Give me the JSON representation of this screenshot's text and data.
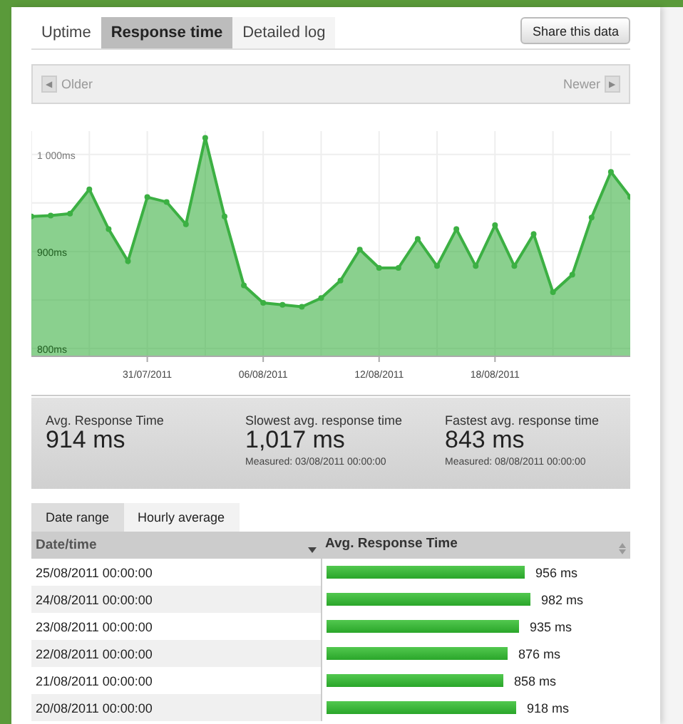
{
  "tabs": [
    {
      "label": "Uptime",
      "selected": false
    },
    {
      "label": "Response time",
      "selected": true
    },
    {
      "label": "Detailed log",
      "selected": false
    }
  ],
  "share_button": "Share this data",
  "navigation": {
    "older": "Older",
    "newer": "Newer",
    "older_icon": "◀",
    "newer_icon": "▶"
  },
  "chart_data": {
    "type": "area",
    "categories": [
      null,
      null,
      null,
      null,
      null,
      null,
      "31/07/2011",
      null,
      null,
      null,
      null,
      null,
      "06/08/2011",
      null,
      null,
      null,
      null,
      null,
      "12/08/2011",
      null,
      null,
      null,
      null,
      null,
      "18/08/2011",
      null,
      null,
      null,
      null,
      null,
      null,
      null
    ],
    "series": [
      {
        "color": "#3cb043",
        "values": [
          936,
          937,
          939,
          964,
          923,
          890,
          956,
          951,
          928,
          1017,
          936,
          865,
          847,
          845,
          843,
          852,
          870,
          902,
          883,
          883,
          913,
          885,
          923,
          885,
          927,
          885,
          918,
          858,
          876,
          935,
          982,
          956
        ]
      }
    ],
    "ylim": [
      792,
      1024
    ],
    "grid": true,
    "yticks": [
      {
        "value": 800,
        "label": "800ms"
      },
      {
        "value": 900,
        "label": "900ms"
      },
      {
        "value": 1000,
        "label": "1 000ms"
      }
    ]
  },
  "stats": [
    {
      "label": "Avg. Response Time",
      "value": "914 ms"
    },
    {
      "label": "Slowest avg. response time",
      "value": "1,017 ms",
      "measured": "Measured: 03/08/2011 00:00:00"
    },
    {
      "label": "Fastest avg. response time",
      "value": "843 ms",
      "measured": "Measured: 08/08/2011 00:00:00"
    }
  ],
  "sub_tabs": [
    {
      "label": "Date range",
      "selected": true
    },
    {
      "label": "Hourly average",
      "selected": false
    }
  ],
  "table": {
    "columns": [
      "Date/time",
      "Avg. Response Time"
    ],
    "rows": [
      {
        "date": "25/08/2011 00:00:00",
        "level": 0.66,
        "reading": "956 ms"
      },
      {
        "date": "24/08/2011 00:00:00",
        "level": 0.68,
        "reading": "982 ms"
      },
      {
        "date": "23/08/2011 00:00:00",
        "level": 0.645,
        "reading": "935 ms"
      },
      {
        "date": "22/08/2011 00:00:00",
        "level": 0.605,
        "reading": "876 ms"
      },
      {
        "date": "21/08/2011 00:00:00",
        "level": 0.59,
        "reading": "858 ms"
      },
      {
        "date": "20/08/2011 00:00:00",
        "level": 0.635,
        "reading": "918 ms"
      }
    ]
  }
}
